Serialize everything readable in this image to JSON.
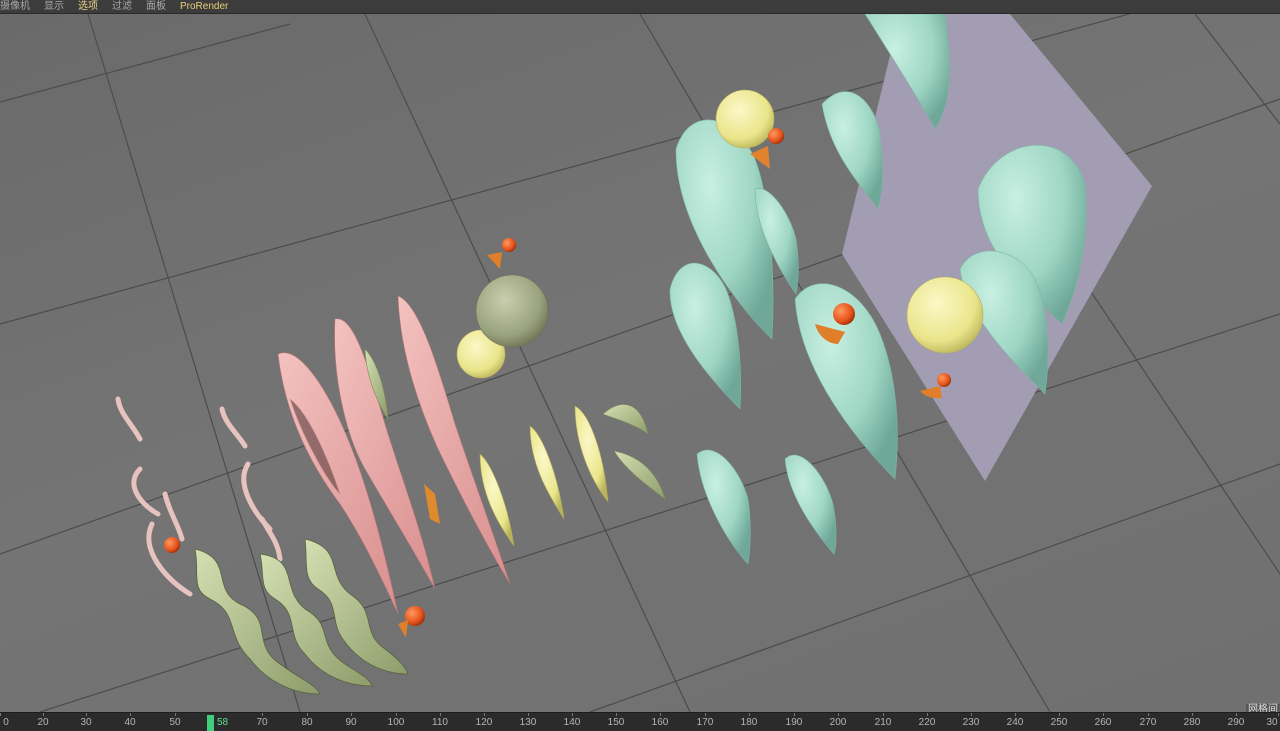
{
  "menubar": {
    "items": [
      {
        "label": "摄像机",
        "state": "normal"
      },
      {
        "label": "显示",
        "state": "normal"
      },
      {
        "label": "选项",
        "state": "active"
      },
      {
        "label": "过滤",
        "state": "normal"
      },
      {
        "label": "面板",
        "state": "normal"
      },
      {
        "label": "ProRender",
        "state": "brand"
      }
    ]
  },
  "viewport": {
    "overlay_label": "网格间",
    "colors": {
      "background": "#707070",
      "grid_line": "#4a4a4a",
      "plane": "#a39fb5",
      "teal_leaf": "#9fd9c6",
      "yellow_sphere": "#f2ec9c",
      "olive_sphere": "#a7ad8a",
      "orange_bead": "#e6531c",
      "pink_ribbon": "#e7aaa8",
      "yellow_leaf": "#e3e18c",
      "green_spiral": "#bccb9a"
    }
  },
  "timeline": {
    "current_frame": "58",
    "ticks": [
      "0",
      "20",
      "30",
      "40",
      "50",
      "70",
      "80",
      "90",
      "100",
      "110",
      "120",
      "130",
      "140",
      "150",
      "160",
      "170",
      "180",
      "190",
      "200",
      "210",
      "220",
      "230",
      "240",
      "250",
      "260",
      "270",
      "280",
      "290",
      "30"
    ]
  }
}
